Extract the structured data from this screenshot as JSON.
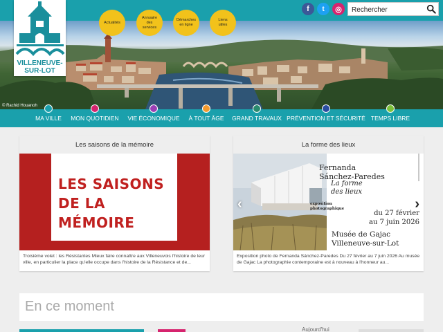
{
  "header": {
    "search_placeholder": "Rechercher",
    "social": [
      {
        "name": "facebook",
        "glyph": "f",
        "color": "#3b5998"
      },
      {
        "name": "twitter",
        "glyph": "t",
        "color": "#1da1f2"
      },
      {
        "name": "instagram",
        "glyph": "◎",
        "color": "#d6246e"
      }
    ]
  },
  "logo": {
    "line1": "VILLENEUVE-",
    "line2": "SUR-LOT"
  },
  "hero": {
    "credit": "© Rachid Houanoh"
  },
  "quick_links": [
    {
      "label": "Actualités"
    },
    {
      "label": "Annuaire des services"
    },
    {
      "label": "Démarches en ligne"
    },
    {
      "label": "Liens utiles"
    }
  ],
  "nav": [
    {
      "label": "MA VILLE",
      "color": "#1aa0ac"
    },
    {
      "label": "MON QUOTIDIEN",
      "color": "#d6246e"
    },
    {
      "label": "VIE ÉCONOMIQUE",
      "color": "#9b3fb5"
    },
    {
      "label": "À TOUT ÂGE",
      "color": "#f29a2e"
    },
    {
      "label": "GRAND TRAVAUX",
      "color": "#2a8a6e"
    },
    {
      "label": "PRÉVENTION ET SÉCURITÉ",
      "color": "#2a4da0"
    },
    {
      "label": "TEMPS LIBRE",
      "color": "#7cc13a"
    }
  ],
  "cards": [
    {
      "title": "Les saisons de la mémoire",
      "poster_lines": [
        "LES SAISONS",
        "DE LA",
        "MÉMOIRE"
      ],
      "description": "Troisième volet : les Résistantes Mieux faire connaître aux Villeneuvois l'histoire de leur ville, en particulier la place qu'elle occupe dans l'histoire de la Résistance et de..."
    },
    {
      "title": "La forme des lieux",
      "artist_line1": "Fernanda",
      "artist_line2": "Sánchez-Paredes",
      "expo_title1": "La forme",
      "expo_title2": "des lieux",
      "expo_type1": "exposition",
      "expo_type2": "photographique",
      "date1": "du 27 février",
      "date2": "au 7 juin 2026",
      "venue1": "Musée de Gajac",
      "venue2": "Villeneuve-sur-Lot",
      "description": "Exposition photo de Fernanda Sánchez-Paredes Du 27 février au 7 juin 2026 Au musée de Gajac La photographie contemporaine est à nouveau à l'honneur au..."
    }
  ],
  "moment": {
    "title": "En ce moment",
    "today": "Aujourd'hui"
  }
}
